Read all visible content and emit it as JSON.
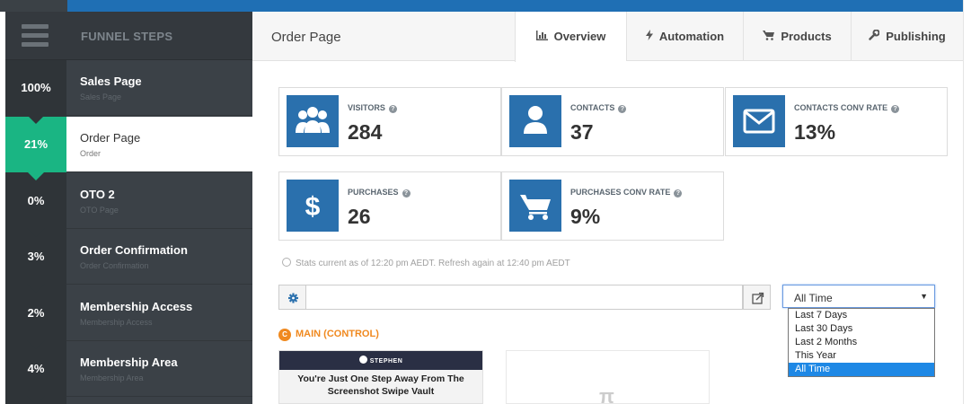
{
  "sidebar": {
    "title": "FUNNEL STEPS",
    "steps": [
      {
        "pct": "100%",
        "name": "Sales Page",
        "sub": "Sales Page"
      },
      {
        "pct": "21%",
        "name": "Order Page",
        "sub": "Order"
      },
      {
        "pct": "0%",
        "name": "OTO 2",
        "sub": "OTO Page"
      },
      {
        "pct": "3%",
        "name": "Order Confirmation",
        "sub": "Order Confirmation"
      },
      {
        "pct": "2%",
        "name": "Membership Access",
        "sub": "Membership Access"
      },
      {
        "pct": "4%",
        "name": "Membership Area",
        "sub": "Membership Area"
      }
    ]
  },
  "header": {
    "title": "Order Page",
    "tabs": [
      {
        "label": "Overview",
        "icon": "bar-chart-icon"
      },
      {
        "label": "Automation",
        "icon": "bolt-icon"
      },
      {
        "label": "Products",
        "icon": "cart-icon"
      },
      {
        "label": "Publishing",
        "icon": "wrench-icon"
      }
    ]
  },
  "stats": {
    "visitors": {
      "label": "VISITORS",
      "value": "284",
      "icon": "users-icon"
    },
    "contacts": {
      "label": "CONTACTS",
      "value": "37",
      "icon": "user-icon"
    },
    "contacts_conv": {
      "label": "CONTACTS CONV RATE",
      "value": "13%",
      "icon": "envelope-icon"
    },
    "purchases": {
      "label": "PURCHASES",
      "value": "26",
      "icon": "dollar-icon"
    },
    "purchases_conv": {
      "label": "PURCHASES CONV RATE",
      "value": "9%",
      "icon": "cart-icon"
    },
    "help_glyph": "?",
    "note": "Stats current as of 12:20 pm AEDT. Refresh again at 12:40 pm AEDT"
  },
  "url_bar": {
    "value": "",
    "placeholder": ""
  },
  "range_select": {
    "selected": "All Time",
    "options": [
      "Last 7 Days",
      "Last 30 Days",
      "Last 2 Months",
      "This Year",
      "All Time"
    ]
  },
  "variation": {
    "badge": "C",
    "label": "MAIN (CONTROL)",
    "thumb_logo": "STEPHEN",
    "thumb_headline": "You're Just One Step Away From The Screenshot Swipe Vault"
  },
  "colors": {
    "accent_blue": "#2a70ad",
    "active_green": "#1ab583",
    "orange": "#f0891f"
  }
}
